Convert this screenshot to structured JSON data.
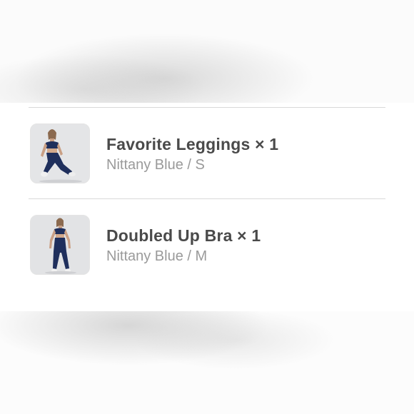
{
  "line_items": [
    {
      "title": "Favorite Leggings × 1",
      "variant": "Nittany Blue / S",
      "thumbnail_icon": "product-photo-leggings"
    },
    {
      "title": "Doubled Up Bra × 1",
      "variant": "Nittany Blue / M",
      "thumbnail_icon": "product-photo-bra"
    }
  ],
  "colors": {
    "product_blue": "#1f2f5c",
    "title_text": "#4a4a4a",
    "variant_text": "#9a9a9a",
    "divider": "#d9d9d9"
  }
}
